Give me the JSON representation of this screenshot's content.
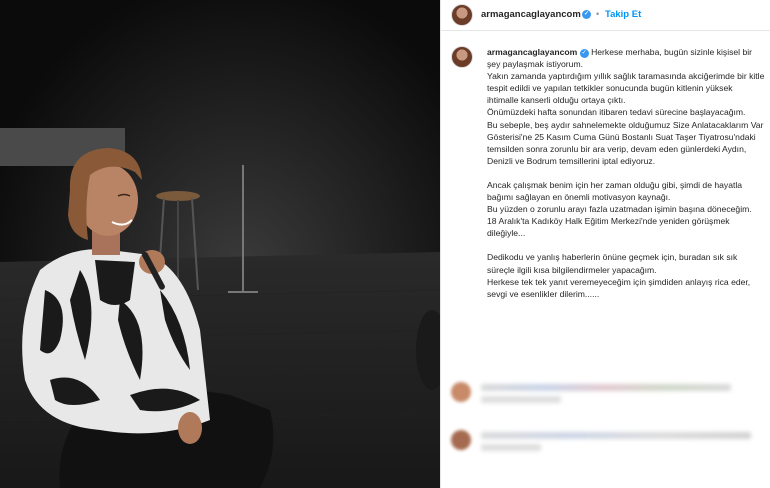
{
  "post": {
    "username": "armagancaglayancom",
    "follow_label": "Takip Et",
    "separator": "•",
    "verified_mark": "✓",
    "caption_lines": [
      "Herkese merhaba, bugün sizinle kişisel bir şey paylaşmak istiyorum.",
      "Yakın zamanda yaptırdığım yıllık sağlık taramasında akciğerimde bir kitle tespit edildi ve yapılan tetkikler sonucunda bugün kitlenin yüksek ihtimalle kanserli olduğu ortaya çıktı.",
      "Önümüzdeki hafta sonundan itibaren tedavi sürecine başlayacağım.",
      "Bu sebeple, beş aydır sahnelemekte olduğumuz Size Anlatacaklarım Var Gösterisi'ne 25 Kasım Cuma Günü Bostanlı Suat Taşer Tiyatrosu'ndaki temsilden sonra zorunlu bir ara verip, devam eden günlerdeki Aydın, Denizli ve Bodrum temsillerini iptal ediyoruz.",
      "",
      "Ancak çalışmak benim için her zaman olduğu gibi, şimdi de hayatla bağımı sağlayan en önemli motivasyon kaynağı.",
      "Bu yüzden o zorunlu arayı fazla uzatmadan işimin başına döneceğim.",
      "18 Aralık'ta Kadıköy Halk Eğitim Merkezi'nde yeniden görüşmek dileğiyle...",
      "",
      "Dedikodu ve yanlış haberlerin önüne geçmek için, buradan sık sık süreçle ilgili kısa bilgilendirmeler yapacağım.",
      "Herkese tek tek yanıt veremeyeceğim için şimdiden anlayış rica eder, sevgi ve esenlikler dilerim......"
    ]
  },
  "colors": {
    "link_blue": "#0095f6",
    "verified_blue": "#3897f0",
    "text": "#262626"
  }
}
